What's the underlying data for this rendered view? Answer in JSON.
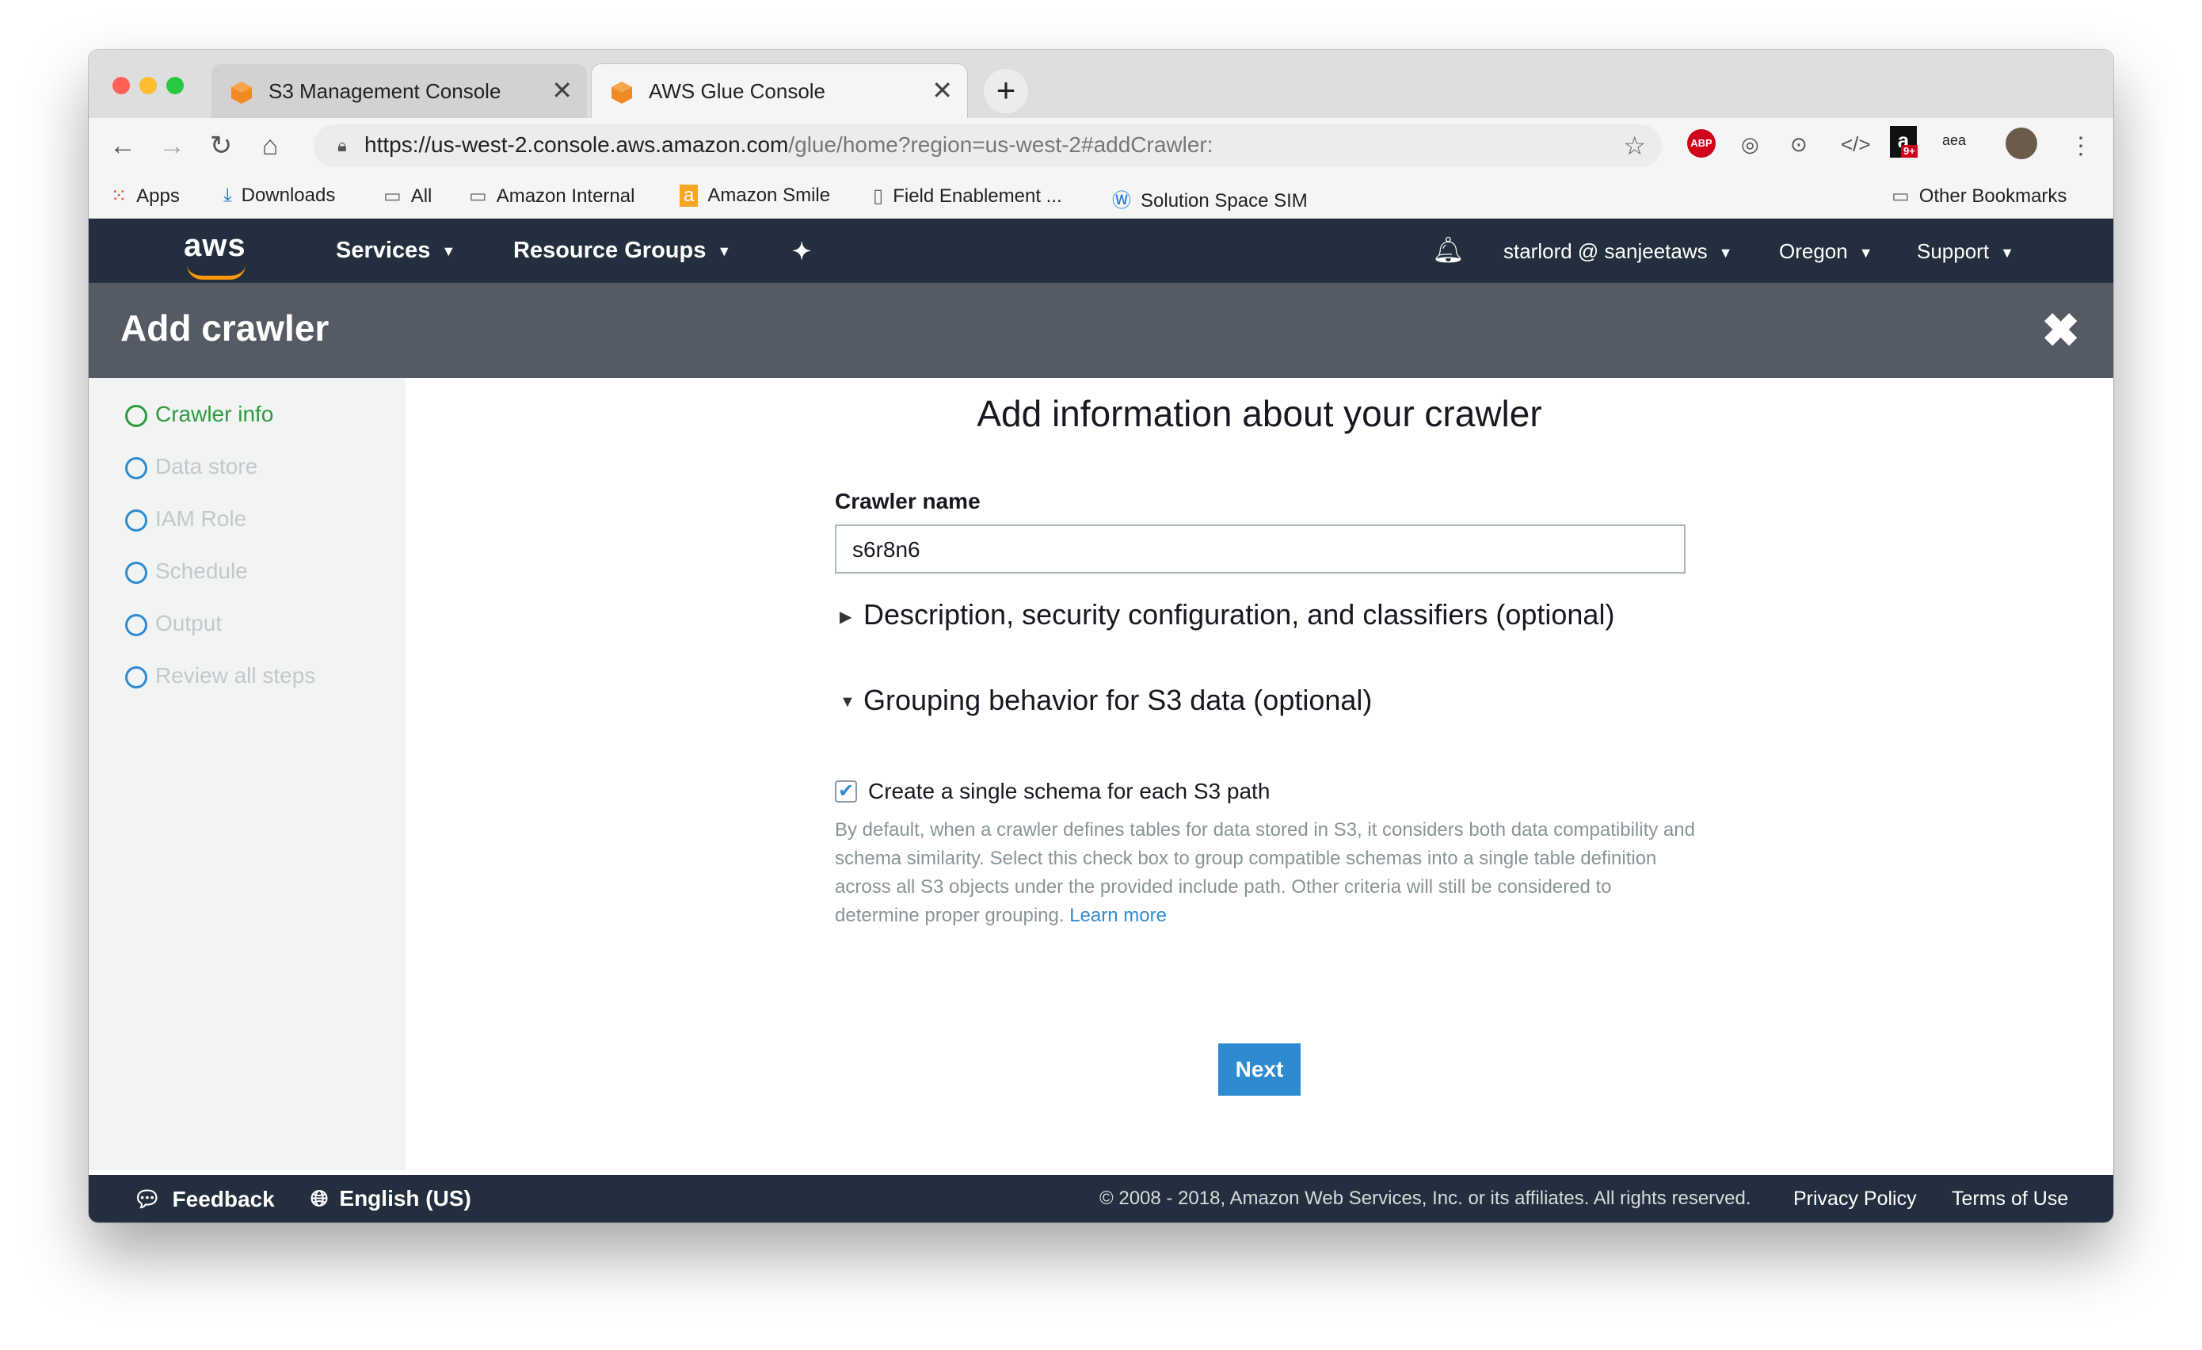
{
  "browser": {
    "tabs": [
      {
        "title": "S3 Management Console",
        "active": false
      },
      {
        "title": "AWS Glue Console",
        "active": true
      }
    ],
    "new_tab": "+",
    "close_tab": "✕",
    "url_host": "https://us-west-2.console.aws.amazon.com",
    "url_path": "/glue/home?region=us-west-2#addCrawler:",
    "bookmarks": [
      "Apps",
      "Downloads",
      "All",
      "Amazon Internal",
      "Amazon Smile",
      "Field Enablement ...",
      "Solution Space SIM"
    ],
    "other_bookmarks": "Other Bookmarks",
    "extension_badge": "9+",
    "extension_abp": "ABP",
    "extension_aea": "aea"
  },
  "aws_nav": {
    "logo": "aws",
    "services": "Services",
    "resource_groups": "Resource Groups",
    "user": "starlord @ sanjeetaws",
    "region": "Oregon",
    "support": "Support"
  },
  "page": {
    "title": "Add crawler",
    "steps": [
      "Crawler info",
      "Data store",
      "IAM Role",
      "Schedule",
      "Output",
      "Review all steps"
    ],
    "heading": "Add information about your crawler",
    "crawler_name_label": "Crawler name",
    "crawler_name_value": "s6r8n6",
    "section_description": "Description, security configuration, and classifiers (optional)",
    "section_grouping": "Grouping behavior for S3 data (optional)",
    "checkbox_label": "Create a single schema for each S3 path",
    "checkbox_checked": true,
    "help_text": "By default, when a crawler defines tables for data stored in S3, it considers both data compatibility and schema similarity. Select this check box to group compatible schemas into a single table definition across all S3 objects under the provided include path. Other criteria will still be considered to determine proper grouping.",
    "learn_more": "Learn more",
    "next_button": "Next"
  },
  "footer": {
    "feedback": "Feedback",
    "language": "English (US)",
    "copyright": "© 2008 - 2018, Amazon Web Services, Inc. or its affiliates. All rights reserved.",
    "privacy": "Privacy Policy",
    "terms": "Terms of Use"
  },
  "colors": {
    "aws_navy": "#232f3e",
    "header_gray": "#545b64",
    "accent_blue": "#2e8bd0",
    "step_green": "#2e9b3f",
    "aws_orange": "#ff9900"
  }
}
